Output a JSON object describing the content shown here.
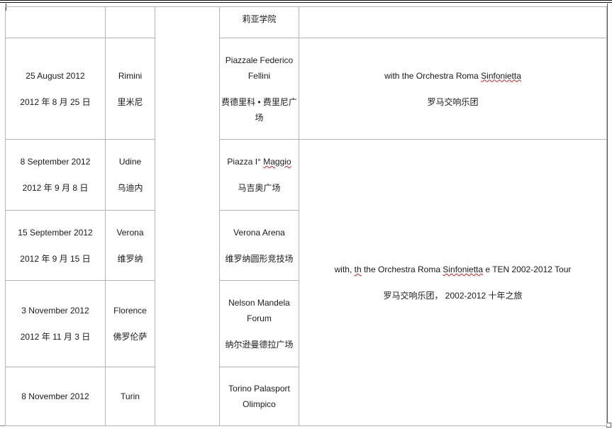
{
  "header_row": {
    "venue_cn": "莉亚学院"
  },
  "rows": [
    {
      "date_en": "25 August 2012",
      "date_cn": "2012 年 8 月 25 日",
      "city_en": "Rimini",
      "city_cn": "里米尼",
      "venue_en": "Piazzale Federico Fellini",
      "venue_cn": "费德里科 • 费里尼广场"
    },
    {
      "date_en": "8 September 2012",
      "date_cn": "2012 年 9 月 8 日",
      "city_en": "Udine",
      "city_cn": "乌迪内",
      "venue_en_prefix": "Piazza I° ",
      "venue_en_misspelled": "Maggio",
      "venue_cn": "马吉奥广场"
    },
    {
      "date_en": "15 September 2012",
      "date_cn": "2012 年 9 月 15 日",
      "city_en": "Verona",
      "city_cn": "维罗纳",
      "venue_en": "Verona Arena",
      "venue_cn": "维罗纳圆形竞技场"
    },
    {
      "date_en": "3 November 2012",
      "date_cn": "2012 年 11 月 3 日",
      "city_en": "Florence",
      "city_cn": "佛罗伦萨",
      "venue_en": "Nelson Mandela Forum",
      "venue_cn": "纳尔逊曼德拉广场"
    },
    {
      "date_en": "8 November 2012",
      "city_en": "Turin",
      "venue_en": "Torino Palasport Olimpico"
    }
  ],
  "notes": {
    "rimini_en_prefix": "with the Orchestra Roma ",
    "rimini_en_misspelled": "Sinfonietta",
    "rimini_cn": "罗马交响乐团",
    "tour_en_a": "with, ",
    "tour_en_misspelled_a": "th",
    "tour_en_b": " the Orchestra Roma ",
    "tour_en_misspelled_b": "Sinfonietta",
    "tour_en_c": " e TEN 2002-2012 Tour",
    "tour_cn": "罗马交响乐团， 2002-2012 十年之旅"
  }
}
